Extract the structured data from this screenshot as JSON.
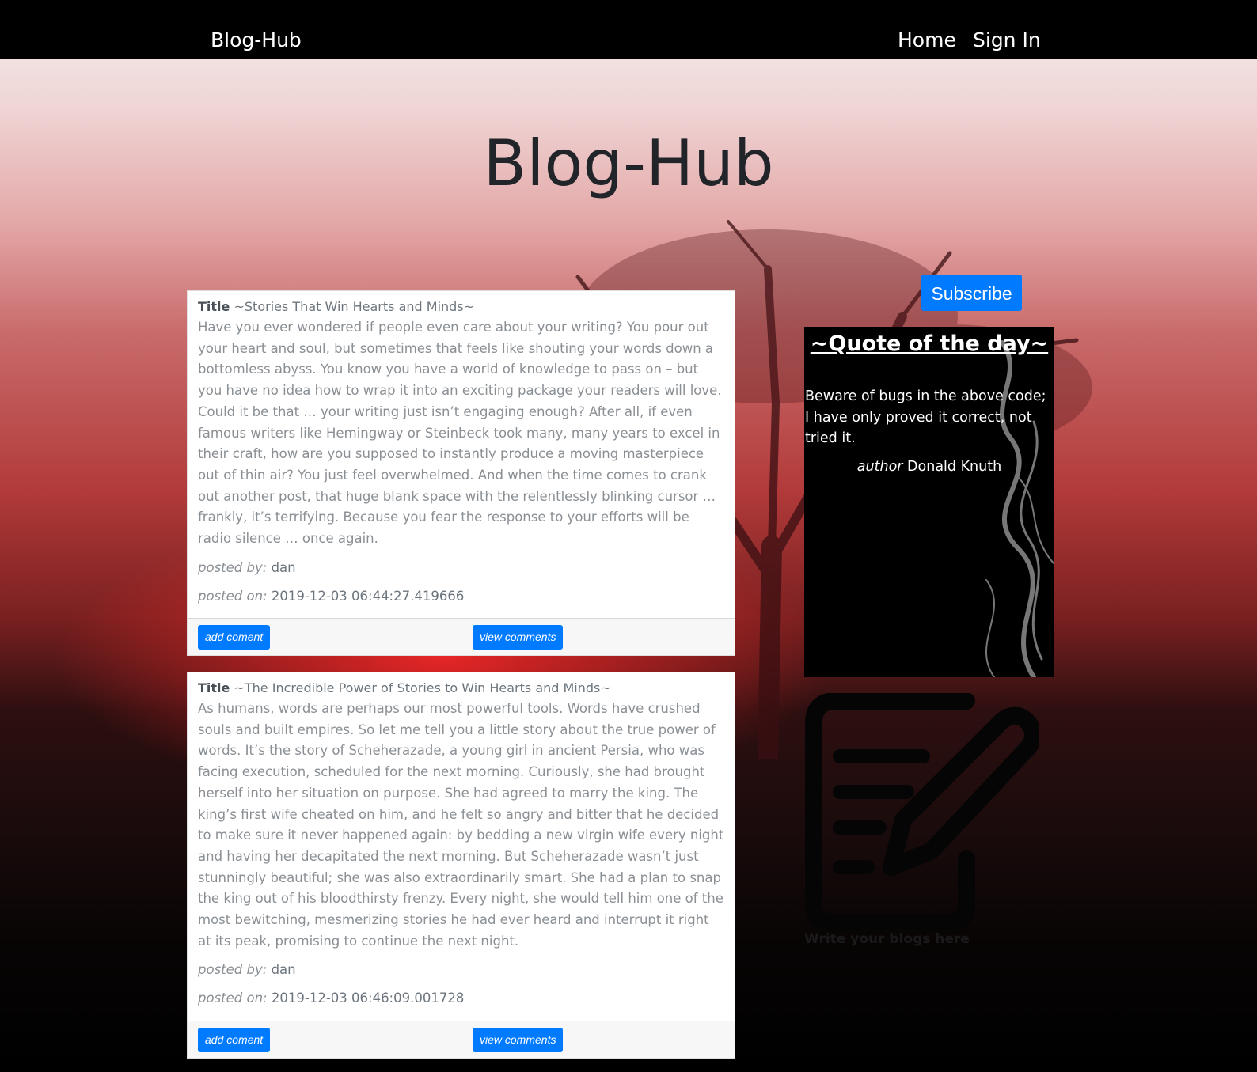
{
  "navbar": {
    "brand": "Blog-Hub",
    "links": [
      "Home",
      "Sign In"
    ]
  },
  "hero": {
    "title": "Blog-Hub"
  },
  "posts": [
    {
      "title_label": "Title",
      "title": "~Stories That Win Hearts and Minds~",
      "body": "Have you ever wondered if people even care about your writing? You pour out your heart and soul, but sometimes that feels like shouting your words down a bottomless abyss. You know you have a world of knowledge to pass on – but you have no idea how to wrap it into an exciting package your readers will love. Could it be that … your writing just isn’t engaging enough? After all, if even famous writers like Hemingway or Steinbeck took many, many years to excel in their craft, how are you supposed to instantly produce a moving masterpiece out of thin air? You just feel overwhelmed. And when the time comes to crank out another post, that huge blank space with the relentlessly blinking cursor … frankly, it’s terrifying. Because you fear the response to your efforts will be radio silence … once again.",
      "posted_by_label": "posted by:",
      "posted_by": "dan",
      "posted_on_label": "posted on:",
      "posted_on": "2019-12-03 06:44:27.419666",
      "add_comment": "add coment",
      "view_comments": "view comments"
    },
    {
      "title_label": "Title",
      "title": "~The Incredible Power of Stories to Win Hearts and Minds~",
      "body": "As humans, words are perhaps our most powerful tools. Words have crushed souls and built empires. So let me tell you a little story about the true power of words. It’s the story of Scheherazade, a young girl in ancient Persia, who was facing execution, scheduled for the next morning. Curiously, she had brought herself into her situation on purpose. She had agreed to marry the king. The king’s first wife cheated on him, and he felt so angry and bitter that he decided to make sure it never happened again: by bedding a new virgin wife every night and having her decapitated the next morning. But Scheherazade wasn’t just stunningly beautiful; she was also extraordinarily smart. She had a plan to snap the king out of his bloodthirsty frenzy. Every night, she would tell him one of the most bewitching, mesmerizing stories he had ever heard and interrupt it right at its peak, promising to continue the next night.",
      "posted_by_label": "posted by:",
      "posted_by": "dan",
      "posted_on_label": "posted on:",
      "posted_on": "2019-12-03 06:46:09.001728",
      "add_comment": "add coment",
      "view_comments": "view comments"
    }
  ],
  "sidebar": {
    "subscribe": "Subscribe",
    "quote_heading": "~Quote of the day~",
    "quote_text": "Beware of bugs in the above code; I have only proved it correct, not tried it.",
    "author_label": "author",
    "author": "Donald Knuth",
    "write_label": "Write your blogs here",
    "write_icon": "edit-document-icon"
  },
  "colors": {
    "accent": "#007bff",
    "navbar": "#000000"
  }
}
